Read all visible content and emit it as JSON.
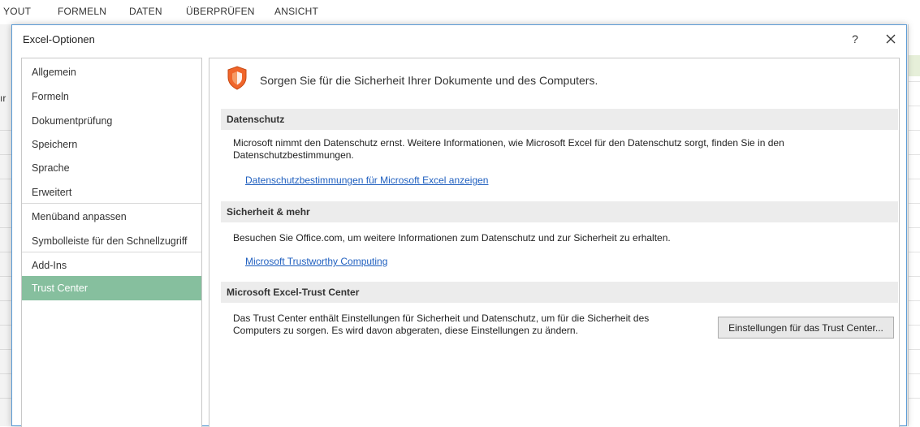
{
  "ribbon": {
    "tabs": [
      "YOUT",
      "FORMELN",
      "DATEN",
      "ÜBERPRÜFEN",
      "ANSICHT"
    ]
  },
  "sheet": {
    "left_fragment": "ır"
  },
  "dialog": {
    "title": "Excel-Optionen",
    "help_label": "?",
    "close_icon": "close-icon"
  },
  "nav": {
    "items": [
      {
        "label": "Allgemein"
      },
      {
        "label": "Formeln"
      },
      {
        "label": "Dokumentprüfung"
      },
      {
        "label": "Speichern"
      },
      {
        "label": "Sprache"
      },
      {
        "label": "Erweitert"
      },
      {
        "label": "Menüband anpassen"
      },
      {
        "label": "Symbolleiste für den Schnellzugriff"
      },
      {
        "label": "Add-Ins"
      },
      {
        "label": "Trust Center"
      }
    ],
    "selected": "Trust Center"
  },
  "main": {
    "shield_icon": "shield-icon",
    "heading": "Sorgen Sie für die Sicherheit Ihrer Dokumente und des Computers.",
    "privacy": {
      "title": "Datenschutz",
      "text_line1": "Microsoft nimmt den Datenschutz ernst. Weitere Informationen, wie Microsoft Excel für den Datenschutz sorgt, finden Sie in den",
      "text_line2": "Datenschutzbestimmungen.",
      "link": "Datenschutzbestimmungen für Microsoft Excel anzeigen"
    },
    "security": {
      "title": "Sicherheit & mehr",
      "text": "Besuchen Sie Office.com, um weitere Informationen zum Datenschutz und zur Sicherheit zu erhalten.",
      "link": "Microsoft Trustworthy Computing"
    },
    "trust_center": {
      "title": "Microsoft Excel-Trust Center",
      "text_line1": "Das Trust Center enthält Einstellungen für Sicherheit und Datenschutz, um für die Sicherheit des",
      "text_line2": "Computers zu sorgen. Es wird davon abgeraten, diese Einstellungen zu ändern.",
      "button": "Einstellungen für das Trust Center..."
    }
  },
  "colors": {
    "selected_nav": "#86bf9e",
    "link": "#1f5fbf",
    "shield": "#f0652a",
    "dialog_border": "#5b9bd5"
  }
}
